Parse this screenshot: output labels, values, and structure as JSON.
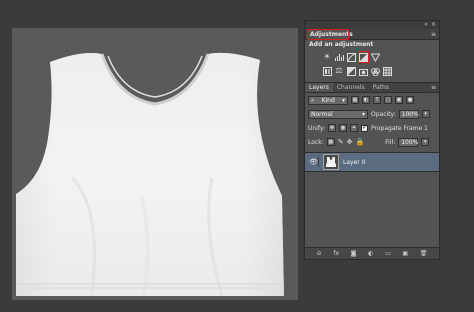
{
  "adjustments": {
    "tab_label": "Adjustments",
    "menu_icon": "≡",
    "heading": "Add an adjustment",
    "row1": [
      "brightness-contrast-icon",
      "levels-icon",
      "curves-icon",
      "exposure-icon",
      "vibrance-icon"
    ],
    "row2": [
      "hue-saturation-icon",
      "color-balance-icon",
      "black-white-icon",
      "photo-filter-icon",
      "channel-mixer-icon",
      "color-lookup-icon"
    ],
    "highlight_color": "#d62020"
  },
  "dock": {
    "collapse": "«",
    "close": "×"
  },
  "layers": {
    "tabs": [
      "Layers",
      "Channels",
      "Paths"
    ],
    "menu_icon": "≡",
    "filter_kind": "Kind",
    "blend_mode": "Normal",
    "opacity_label": "Opacity:",
    "opacity_value": "100%",
    "unify_label": "Unify:",
    "propagate_label": "Propagate Frame 1",
    "lock_label": "Lock:",
    "fill_label": "Fill:",
    "fill_value": "100%",
    "layer_name": "Layer 0",
    "selected_color": "#5b6b80",
    "footer_icons": [
      "link-icon",
      "fx-icon",
      "mask-icon",
      "adjustment-layer-icon",
      "group-icon",
      "new-layer-icon",
      "trash-icon"
    ],
    "footer_glyphs": [
      "⊝",
      "fx",
      "◙",
      "◐",
      "▭",
      "▣",
      "🗑"
    ]
  }
}
